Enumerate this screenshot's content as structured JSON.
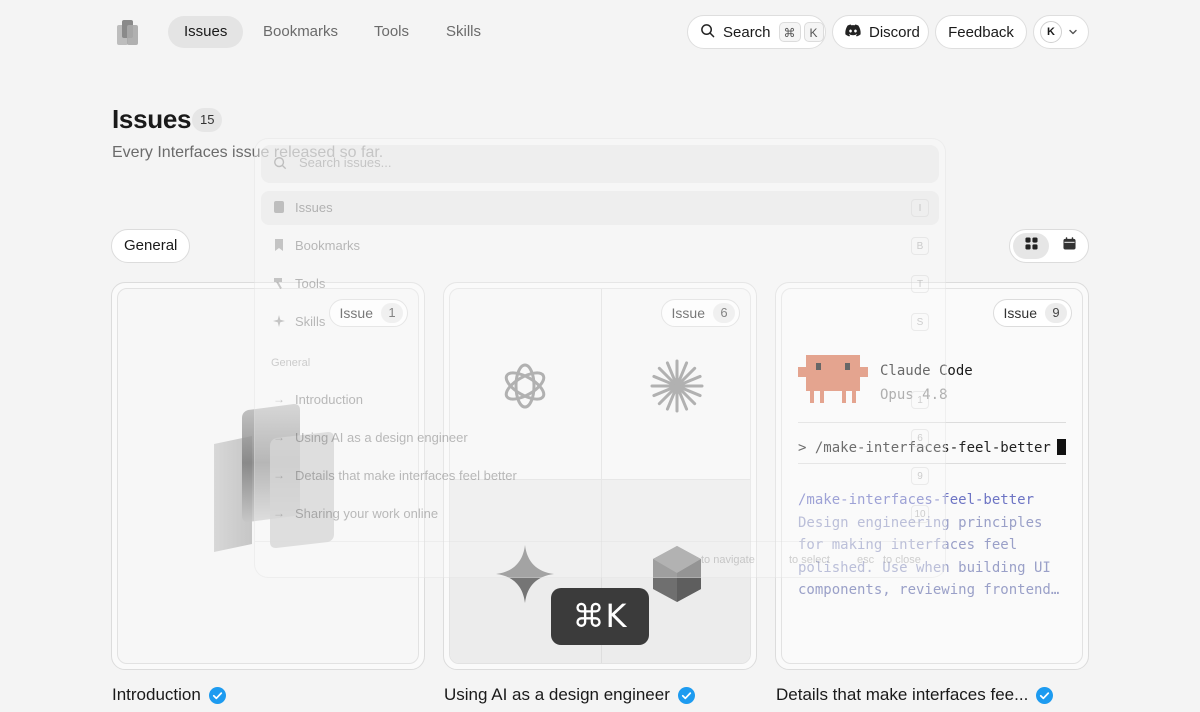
{
  "nav": {
    "tabs": [
      {
        "label": "Issues",
        "active": true
      },
      {
        "label": "Bookmarks"
      },
      {
        "label": "Tools"
      },
      {
        "label": "Skills"
      }
    ],
    "search": {
      "label": "Search",
      "keys": [
        "⌘",
        "K"
      ]
    },
    "discord_label": "Discord",
    "feedback_label": "Feedback",
    "avatar_initial": "K"
  },
  "header": {
    "title": "Issues",
    "count": "15",
    "subtitle": "Every Interfaces issue released so far."
  },
  "filters": {
    "active_chip": "General"
  },
  "cards": [
    {
      "badge_label": "Issue",
      "issue_number": "1",
      "title": "Introduction",
      "verified": true
    },
    {
      "badge_label": "Issue",
      "issue_number": "6",
      "title": "Using AI as a design engineer",
      "verified": true
    },
    {
      "badge_label": "Issue",
      "issue_number": "9",
      "title": "Details that make interfaces fee...",
      "verified": true,
      "terminal": {
        "app_name": "Claude Code",
        "model": "Opus 4.8",
        "command": "> /make-interfaces-feel-better",
        "output": [
          "/make-interfaces-feel-better",
          "Design engineering principles",
          "for making interfaces feel",
          "polished. Use when building UI",
          "components, reviewing frontend…"
        ]
      }
    }
  ],
  "palette": {
    "placeholder": "Search issues...",
    "items": [
      {
        "label": "Issues",
        "key": "I",
        "icon": "document-icon"
      },
      {
        "label": "Bookmarks",
        "key": "B",
        "icon": "bookmark-icon"
      },
      {
        "label": "Tools",
        "key": "T",
        "icon": "hammer-icon"
      },
      {
        "label": "Skills",
        "key": "S",
        "icon": "sparkle-icon"
      }
    ],
    "section_label": "General",
    "issue_items": [
      {
        "label": "Introduction",
        "key": "1"
      },
      {
        "label": "Using AI as a design engineer",
        "key": "6"
      },
      {
        "label": "Details that make interfaces feel better",
        "key": "9"
      },
      {
        "label": "Sharing your work online",
        "key": "10"
      }
    ],
    "footer": {
      "navigate": "to navigate",
      "select": "to select",
      "esc_key": "esc",
      "close": "to close"
    }
  },
  "shortcut_overlay": "⌘K",
  "colors": {
    "verified_blue": "#1d9bf0",
    "terminal_accent": "#6d74c4",
    "claude_orange": "#d97757"
  }
}
